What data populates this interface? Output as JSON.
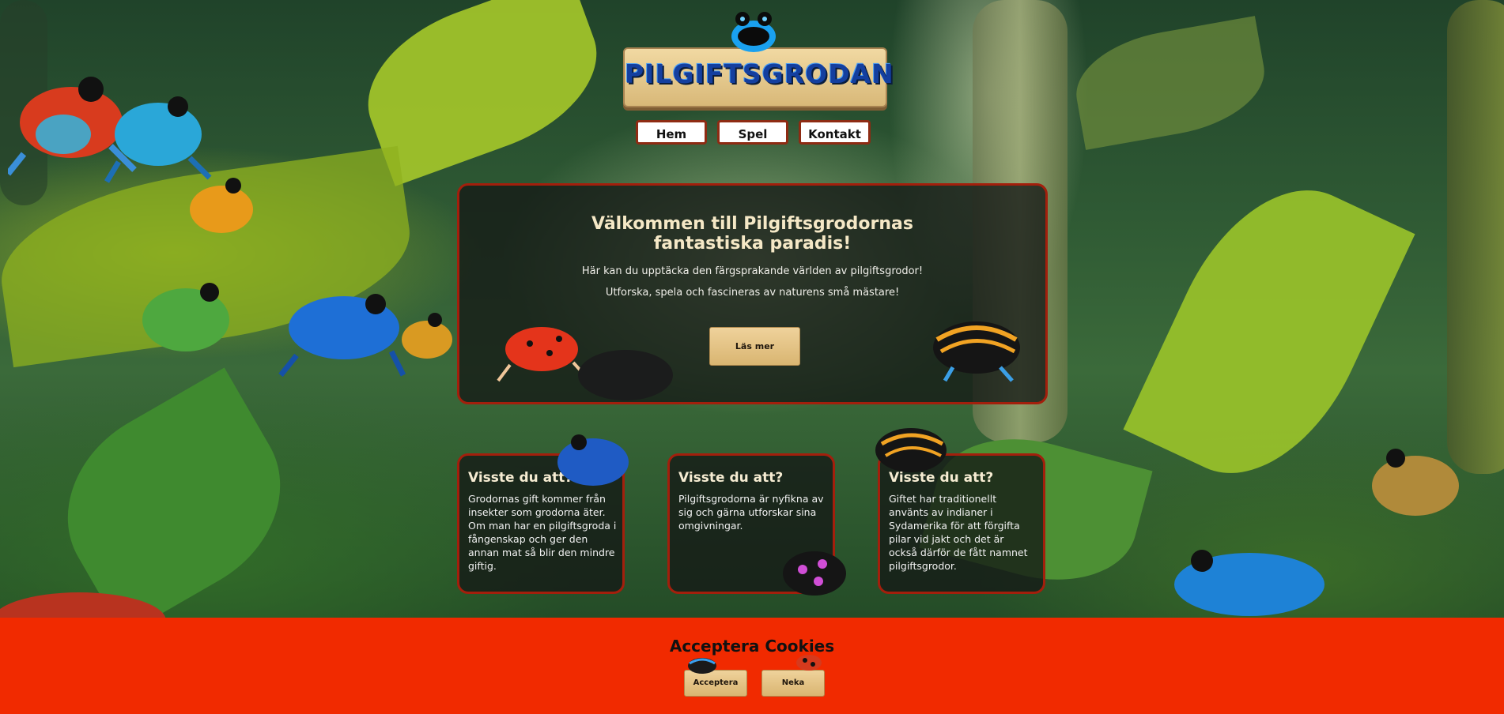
{
  "site": {
    "logo_text": "PILGIFTSGRODAN"
  },
  "nav": {
    "items": [
      "Hem",
      "Spel",
      "Kontakt"
    ]
  },
  "hero": {
    "title_line1": "Välkommen till Pilgiftsgrodornas",
    "title_line2": "fantastiska paradis!",
    "line1": "Här kan du upptäcka den färgsprakande världen av pilgiftsgrodor!",
    "line2": "Utforska, spela och fascineras av naturens små mästare!",
    "button_label": "Läs mer"
  },
  "facts": [
    {
      "title": "Visste du att?",
      "text": "Grodornas gift kommer från insekter som grodorna äter. Om man har en pilgiftsgroda i fångenskap och ger den annan mat så blir den mindre giftig."
    },
    {
      "title": "Visste du att?",
      "text": "Pilgiftsgrodorna är nyfikna av sig och gärna utforskar sina omgivningar."
    },
    {
      "title": "Visste du att?",
      "text": "Giftet har traditionellt använts av indianer i Sydamerika för att förgifta pilar vid jakt och det är också därför de fått namnet pilgiftsgrodor."
    }
  ],
  "cookies": {
    "title": "Acceptera Cookies",
    "accept_label": "Acceptera",
    "decline_label": "Neka"
  },
  "colors": {
    "accent_red": "#f12a00",
    "card_border": "#a31f0c",
    "wood": "#e2c283",
    "logo_blue": "#143f9f"
  }
}
